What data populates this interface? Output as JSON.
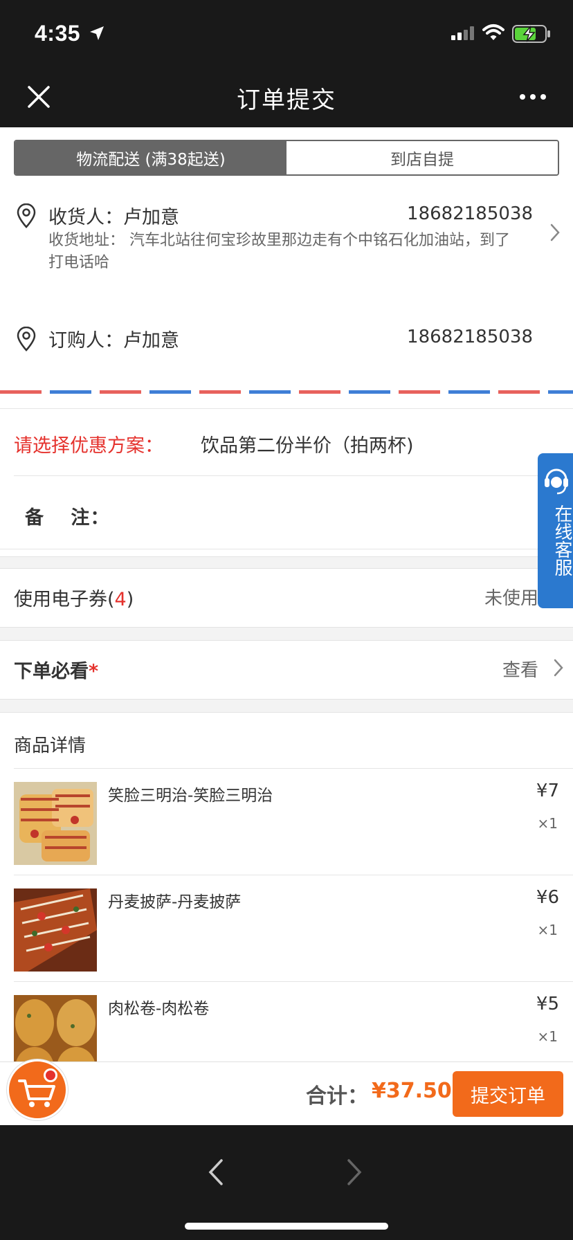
{
  "status_bar": {
    "time": "4:35"
  },
  "nav": {
    "title": "订单提交",
    "close_icon": "close-icon",
    "more_icon": "more-icon"
  },
  "delivery_tabs": {
    "logistics": "物流配送 (满38起送)",
    "pickup": "到店自提",
    "selected": "logistics"
  },
  "receiver": {
    "name_label": "收货人：卢加意",
    "phone": "18682185038",
    "address": "收货地址： 汽车北站往何宝珍故里那边走有个中铭石化加油站，到了打电话哈"
  },
  "buyer": {
    "name_label": "订购人：卢加意",
    "phone": "18682185038"
  },
  "customer_service": {
    "label": "在线客服"
  },
  "promotion": {
    "label": "请选择优惠方案：",
    "value": "饮品第二份半价（拍两杯)"
  },
  "remark": {
    "label": "备　 注："
  },
  "coupon": {
    "label": "使用电子券",
    "count": "4",
    "open": "(",
    "close": ")",
    "status": "未使用"
  },
  "notice": {
    "label": "下单必看",
    "star": "*",
    "action": "查看"
  },
  "goods": {
    "title": "商品详情",
    "items": [
      {
        "name": "笑脸三明治-笑脸三明治",
        "price": "¥7",
        "qty": "×1"
      },
      {
        "name": "丹麦披萨-丹麦披萨",
        "price": "¥6",
        "qty": "×1"
      },
      {
        "name": "肉松卷-肉松卷",
        "price": "¥5",
        "qty": "×1"
      }
    ]
  },
  "footer": {
    "total_label": "合计：",
    "total_value": "¥37.50",
    "submit_label": "提交订单"
  },
  "colors": {
    "accent": "#f26a1b",
    "red": "#e5322d",
    "service_blue": "#2b79cf",
    "bar": "#191919"
  }
}
